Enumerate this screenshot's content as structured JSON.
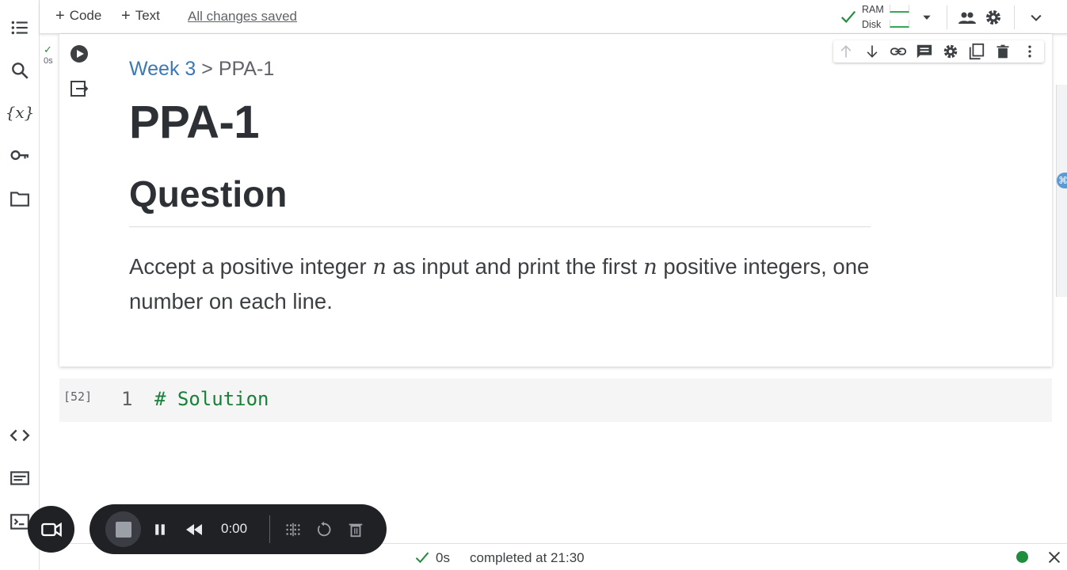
{
  "toolbar": {
    "code_label": "Code",
    "text_label": "Text",
    "save_status": "All changes saved",
    "ram_label": "RAM",
    "disk_label": "Disk"
  },
  "markdown_cell": {
    "run_time": "0s",
    "breadcrumb_link": "Week 3",
    "breadcrumb_sep": ">",
    "breadcrumb_current": "PPA-1",
    "title": "PPA-1",
    "heading": "Question",
    "para_1": "Accept a positive integer ",
    "var": "n",
    "para_2": " as input and print the first ",
    "para_3": " positive integers, one number on each line."
  },
  "code_cell": {
    "exec_count": "[52]",
    "line_number": "1",
    "code": "# Solution"
  },
  "statusbar": {
    "time": "0s",
    "completed": "completed at 21:30"
  },
  "recorder": {
    "timer": "0:00"
  },
  "colors": {
    "accent_link": "#3b78b5",
    "code_comment": "#188038",
    "status_ok": "#1e8e3e"
  },
  "icons": [
    "toc-icon",
    "search-icon",
    "variables-icon",
    "key-icon",
    "folder-icon",
    "code-snippets-icon",
    "command-palette-icon",
    "terminal-icon",
    "check-icon",
    "dropdown-icon",
    "people-icon",
    "gear-icon",
    "chevron-down-icon",
    "run-icon",
    "output-icon",
    "arrow-up-icon",
    "arrow-down-icon",
    "link-icon",
    "comment-icon",
    "copy-icon",
    "trash-icon",
    "more-icon",
    "camera-icon",
    "pause-icon",
    "rewind-icon",
    "grid-icon",
    "reset-icon",
    "close-icon"
  ]
}
